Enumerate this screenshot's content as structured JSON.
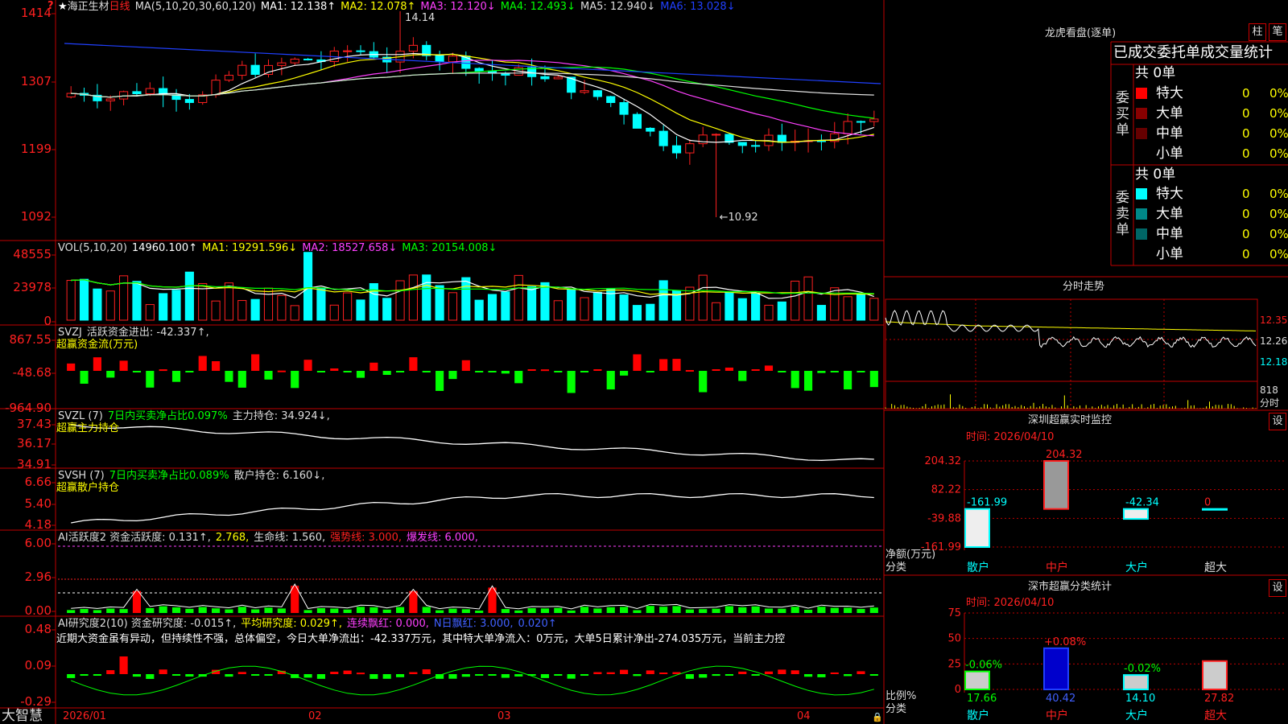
{
  "brand": "大智慧",
  "stock": {
    "star": "★",
    "name": "海正生材",
    "period": "日线"
  },
  "colors": {
    "up": "#ff2020",
    "down": "#00ffff",
    "ma1": "#ffffff",
    "ma2": "#ffff00",
    "ma3": "#ff40ff",
    "ma4": "#00ff00",
    "ma5": "#e0e0e0",
    "ma6": "#2040ff"
  },
  "price_panel": {
    "legend": [
      {
        "text": "MA(5,10,20,30,60,120)",
        "color": "#dddddd"
      },
      {
        "text": "MA1: 12.138↑",
        "color": "#ffffff"
      },
      {
        "text": "MA2: 12.078↑",
        "color": "#ffff00"
      },
      {
        "text": "MA3: 12.120↓",
        "color": "#ff40ff"
      },
      {
        "text": "MA4: 12.493↓",
        "color": "#00ff00"
      },
      {
        "text": "MA5: 12.940↓",
        "color": "#dddddd"
      },
      {
        "text": "MA6: 13.028↓",
        "color": "#2040ff"
      }
    ],
    "y_ticks": [
      "1414",
      "1307",
      "1199",
      "1092"
    ],
    "high_label": "14.14",
    "low_label": "←10.92"
  },
  "chart_data": [
    {
      "type": "candlestick",
      "title": "海正生材 日线",
      "ylim": [
        10.92,
        14.14
      ],
      "x_labels": [
        "2026/01",
        "02",
        "03",
        "04"
      ],
      "high": 14.14,
      "low": 10.92,
      "ma_last": {
        "MA1": 12.138,
        "MA2": 12.078,
        "MA3": 12.12,
        "MA4": 12.493,
        "MA5": 12.94,
        "MA6": 13.028
      }
    },
    {
      "type": "bar",
      "title": "VOL(5,10,20)",
      "ylim": [
        0,
        48555
      ],
      "values": [
        14960.1
      ],
      "ma": {
        "MA1": 19291.596,
        "MA2": 18527.658,
        "MA3": 20154.008
      }
    },
    {
      "type": "bar",
      "title": "SVZJ 活跃资金进出",
      "ylim": [
        -964.9,
        867.55
      ],
      "last": -42.337
    },
    {
      "type": "line",
      "title": "SVZL (7)",
      "ylim": [
        34.91,
        37.43
      ],
      "last": 34.924
    },
    {
      "type": "line",
      "title": "SVSH (7)",
      "ylim": [
        4.18,
        6.66
      ],
      "last": 6.16
    },
    {
      "type": "bar",
      "title": "AI活跃度2",
      "ylim": [
        0,
        6
      ],
      "levels": {
        "strong": 3,
        "burst": 6
      }
    },
    {
      "type": "bar",
      "title": "AI研究度2(10)",
      "ylim": [
        -0.29,
        0.48
      ]
    },
    {
      "type": "bar",
      "title": "深圳超赢实时监控",
      "categories": [
        "散户",
        "中户",
        "大户",
        "超大"
      ],
      "values": [
        -161.99,
        204.32,
        -42.34,
        0
      ],
      "ylim": [
        -161.99,
        204.32
      ]
    },
    {
      "type": "bar",
      "title": "深市超赢分类统计",
      "categories": [
        "散户",
        "中户",
        "大户",
        "超大"
      ],
      "values": [
        17.66,
        40.42,
        14.1,
        27.82
      ],
      "changes": [
        "-0.06%",
        "+0.08%",
        "-0.02%",
        ""
      ],
      "ylim": [
        0,
        75
      ]
    }
  ],
  "vol_panel": {
    "y_ticks": [
      "48555",
      "23978",
      "0"
    ],
    "legend": [
      {
        "text": "VOL(5,10,20)",
        "color": "#dddddd"
      },
      {
        "text": "14960.100↑",
        "color": "#ffffff"
      },
      {
        "text": "MA1: 19291.596↓",
        "color": "#ffff00"
      },
      {
        "text": "MA2: 18527.658↓",
        "color": "#ff40ff"
      },
      {
        "text": "MA3: 20154.008↓",
        "color": "#00ff00"
      }
    ]
  },
  "svzj_panel": {
    "y_ticks": [
      "867.55",
      "-48.68",
      "-964.90"
    ],
    "legend": [
      {
        "text": "SVZJ",
        "color": "#dddddd"
      },
      {
        "text": "活跃资金进出: -42.337↑,",
        "color": "#dddddd"
      }
    ],
    "sub": "超赢资金流(万元)"
  },
  "svzl_panel": {
    "y_ticks": [
      "37.43",
      "36.17",
      "34.91"
    ],
    "legend": [
      {
        "text": "SVZL (7)",
        "color": "#dddddd"
      },
      {
        "text": "7日内买卖净占比0.097%",
        "color": "#00ff00"
      },
      {
        "text": "主力持仓: 34.924↓,",
        "color": "#dddddd"
      }
    ],
    "sub": "超赢主力持仓"
  },
  "svsh_panel": {
    "y_ticks": [
      "6.66",
      "5.40",
      "4.18"
    ],
    "legend": [
      {
        "text": "SVSH (7)",
        "color": "#dddddd"
      },
      {
        "text": "7日内买卖净占比0.089%",
        "color": "#00ff00"
      },
      {
        "text": "散户持仓: 6.160↓,",
        "color": "#dddddd"
      }
    ],
    "sub": "超赢散户持仓"
  },
  "ai_act_panel": {
    "y_ticks": [
      "6.00",
      "2.96",
      "0.00"
    ],
    "legend": [
      {
        "text": "AI活跃度2 资金活跃度: 0.131↑,",
        "color": "#dddddd"
      },
      {
        "text": "2.768,",
        "color": "#ffff00"
      },
      {
        "text": "生命线: 1.560,",
        "color": "#dddddd"
      },
      {
        "text": "强势线: 3.000,",
        "color": "#ff2020"
      },
      {
        "text": "爆发线: 6.000,",
        "color": "#ff40ff"
      }
    ]
  },
  "ai_res_panel": {
    "y_ticks": [
      "0.48",
      "0.09",
      "-0.29"
    ],
    "legend": [
      {
        "text": "AI研究度2(10) 资金研究度: -0.015↑,",
        "color": "#dddddd"
      },
      {
        "text": "平均研究度: 0.029↑,",
        "color": "#ffff00"
      },
      {
        "text": "连续飘红: 0.000,",
        "color": "#ff40ff"
      },
      {
        "text": "N日飘红: 3.000,",
        "color": "#4060ff"
      },
      {
        "text": "0.020↑",
        "color": "#4060ff"
      }
    ],
    "comment": "近期大资金虽有异动，但持续性不强，总体偏空，今日大单净流出：-42.337万元，其中特大单净流入：0万元，大单5日累计净出-274.035万元，当前主力控"
  },
  "x_axis": [
    "2026/01",
    "02",
    "03",
    "04"
  ],
  "lhb": {
    "title": "龙虎看盘(逐单)",
    "btn_col": "柱",
    "btn_tick": "笔",
    "subtitle": "已成交委托单成交量统计",
    "buy": {
      "side": "委买单",
      "total": "共 0单",
      "rows": [
        {
          "label": "特大",
          "count": "0",
          "pct": "0%",
          "color": "#ff0000"
        },
        {
          "label": "大单",
          "count": "0",
          "pct": "0%",
          "color": "#880000"
        },
        {
          "label": "中单",
          "count": "0",
          "pct": "0%",
          "color": "#660000"
        },
        {
          "label": "小单",
          "count": "0",
          "pct": "0%",
          "color": "#000000"
        }
      ]
    },
    "sell": {
      "side": "委卖单",
      "total": "共 0单",
      "rows": [
        {
          "label": "特大",
          "count": "0",
          "pct": "0%",
          "color": "#00ffff"
        },
        {
          "label": "大单",
          "count": "0",
          "pct": "0%",
          "color": "#008888"
        },
        {
          "label": "中单",
          "count": "0",
          "pct": "0%",
          "color": "#006666"
        },
        {
          "label": "小单",
          "count": "0",
          "pct": "0%",
          "color": "#000000"
        }
      ]
    }
  },
  "intraday": {
    "title": "分时走势",
    "y_ticks": [
      "12.35",
      "12.26",
      "12.18"
    ],
    "vol_ticks": [
      "818",
      "分时"
    ]
  },
  "szmon": {
    "title": "深圳超赢实时监控",
    "btn": "设",
    "time": "时间: 2026/04/10",
    "y_ticks": [
      "204.32",
      "82.22",
      "-39.88",
      "-161.99"
    ],
    "value_labels": [
      "-161.99",
      "204.32",
      "-42.34",
      "0"
    ],
    "axis_title": "净额(万元)",
    "cat_title": "分类",
    "cats": [
      "散户",
      "中户",
      "大户",
      "超大"
    ]
  },
  "szcls": {
    "title": "深市超赢分类统计",
    "btn": "设",
    "time": "时间: 2026/04/10",
    "y_ticks": [
      "75",
      "50",
      "25",
      "0"
    ],
    "pct_labels": [
      "-0.06%",
      "+0.08%",
      "-0.02%"
    ],
    "value_labels": [
      "17.66",
      "40.42",
      "14.10",
      "27.82"
    ],
    "axis_title": "比例%",
    "cat_title": "分类",
    "cats": [
      "散户",
      "中户",
      "大户",
      "超大"
    ]
  }
}
